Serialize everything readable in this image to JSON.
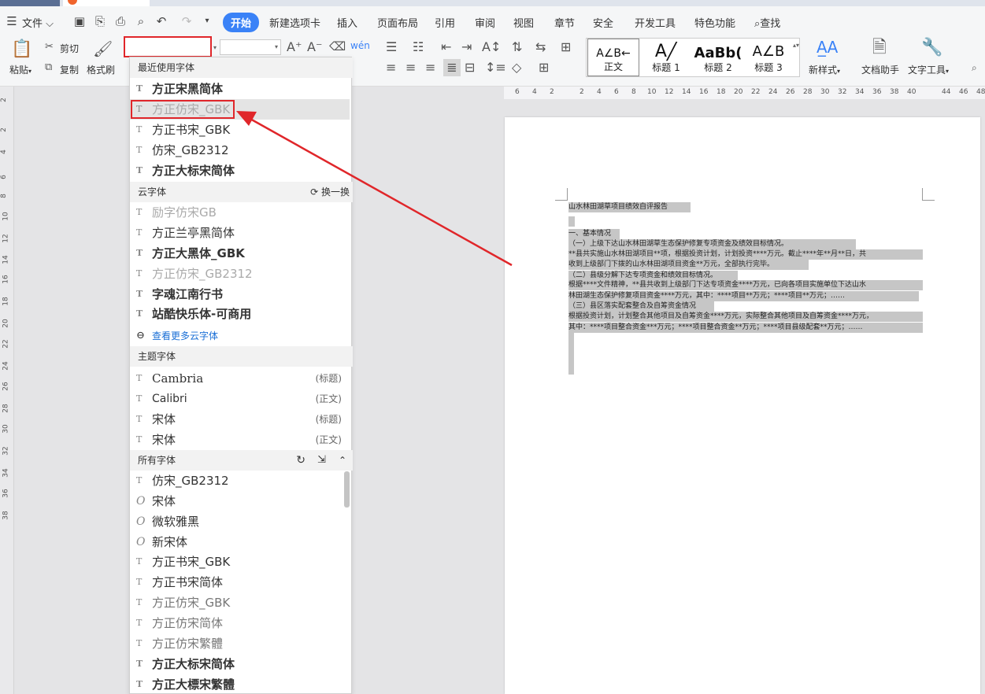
{
  "menubar": {
    "file": "文件",
    "tabs": [
      "开始",
      "新建选项卡",
      "插入",
      "页面布局",
      "引用",
      "审阅",
      "视图",
      "章节",
      "安全",
      "开发工具",
      "特色功能"
    ],
    "search": "查找"
  },
  "ribbon": {
    "paste": "粘贴",
    "cut": "剪切",
    "copy": "复制",
    "format_painter": "格式刷",
    "styles": [
      {
        "preview": "A∠B←",
        "label": "正文"
      },
      {
        "preview": "A╱",
        "label": "标题 1"
      },
      {
        "preview": "AaBb(",
        "label": "标题 2"
      },
      {
        "preview": "A∠B",
        "label": "标题 3"
      }
    ],
    "new_style": "新样式",
    "doc_helper": "文档助手",
    "text_tools": "文字工具"
  },
  "font_dropdown": {
    "recent_header": "最近使用字体",
    "recent": [
      "方正宋黑简体",
      "方正仿宋_GBK",
      "方正书宋_GBK",
      "仿宋_GB2312",
      "方正大标宋简体"
    ],
    "cloud_header": "云字体",
    "cloud_action": "换一换",
    "cloud": [
      "励字仿宋GB",
      "方正兰亭黑简体",
      "方正大黑体_GBK",
      "方正仿宋_GB2312",
      "字魂江南行书",
      "站酷快乐体-可商用"
    ],
    "more_cloud": "查看更多云字体",
    "theme_header": "主题字体",
    "theme": [
      {
        "name": "Cambria",
        "tag": "(标题)"
      },
      {
        "name": "Calibri",
        "tag": "(正文)"
      },
      {
        "name": "宋体",
        "tag": "(标题)"
      },
      {
        "name": "宋体",
        "tag": "(正文)"
      }
    ],
    "all_header": "所有字体",
    "all": [
      "仿宋_GB2312",
      "宋体",
      "微软雅黑",
      "新宋体",
      "方正书宋_GBK",
      "方正书宋简体",
      "方正仿宋_GBK",
      "方正仿宋简体",
      "方正仿宋繁體",
      "方正大标宋简体",
      "方正大標宋繁體"
    ]
  },
  "document": {
    "lines": [
      "山水林田湖草项目绩效自评报告",
      "",
      "一、基本情况",
      "（一）上级下达山水林田湖草生态保护修复专项资金及绩效目标情况。",
      "**县共实施山水林田湖项目**项，根据投资计划，计划投资****万元。截止****年**月**日，共",
      "收到上级部门下拨的山水林田湖项目资金**万元，全部执行完毕。",
      "（二）县级分解下达专项资金和绩效目标情况。",
      "根据****文件精神，**县共收到上级部门下达专项资金****万元，已向各项目实施单位下达山水",
      "林田湖生态保护修复项目资金****万元，其中：****项目**万元；****项目**万元；……",
      "（三）县区落实配套整合及自筹资金情况",
      "根据投资计划，计划整合其他项目及自筹资金****万元，实际整合其他项目及自筹资金****万元，",
      "其中：****项目整合资金***万元；****项目整合资金**万元；****项目县级配套**万元；……"
    ]
  },
  "vruler_marks": [
    "2",
    "2",
    "4",
    "6",
    "8",
    "10",
    "12",
    "14",
    "16",
    "18",
    "20",
    "22",
    "24",
    "26",
    "28",
    "30",
    "32",
    "34",
    "36",
    "38"
  ],
  "hruler_marks": [
    "6",
    "4",
    "2",
    "2",
    "4",
    "6",
    "8",
    "10",
    "12",
    "14",
    "16",
    "18",
    "20",
    "22",
    "24",
    "26",
    "28",
    "30",
    "32",
    "34",
    "36",
    "38",
    "40",
    "44",
    "46",
    "48"
  ]
}
